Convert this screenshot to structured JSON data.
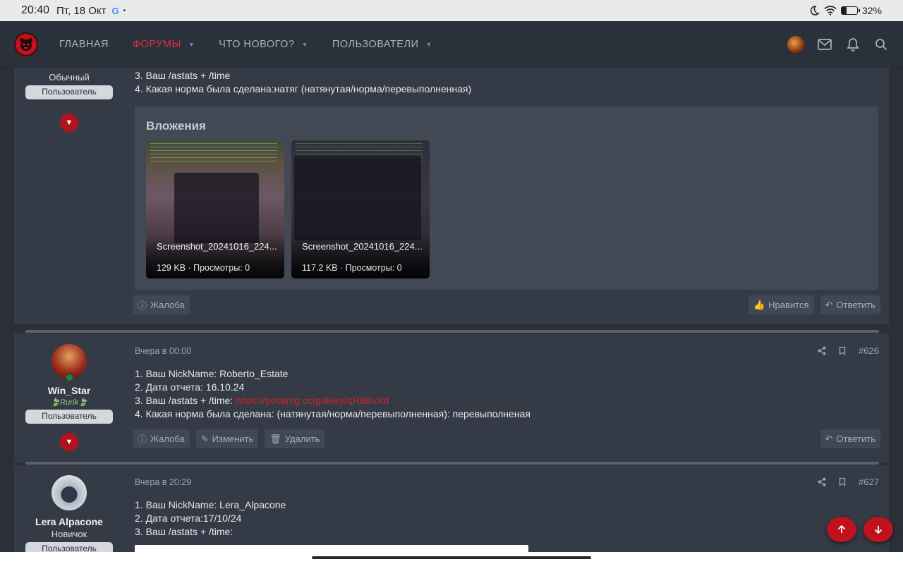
{
  "statusbar": {
    "time": "20:40",
    "date": "Пт, 18 Окт",
    "google": "G",
    "dot": "•",
    "battery_percent": "32",
    "battery_level": 0.32
  },
  "nav": {
    "items": [
      {
        "label": "ГЛАВНАЯ",
        "active": false
      },
      {
        "label": "ФОРУМЫ",
        "active": true
      },
      {
        "label": "ЧТО НОВОГО?",
        "active": false
      },
      {
        "label": "ПОЛЬЗОВАТЕЛИ",
        "active": false
      }
    ]
  },
  "post1": {
    "user_title": "Обычный",
    "role": "Пользователь",
    "lines": [
      "3. Ваш /astats + /time",
      "4. Какая норма была сделана:натяг (натянутая/норма/перевыполненная)"
    ],
    "attachments_title": "Вложения",
    "attachments": [
      {
        "name": "Screenshot_20241016_224...",
        "size": "129 KB",
        "views": "Просмотры: 0"
      },
      {
        "name": "Screenshot_20241016_224...",
        "size": "117.2 KB",
        "views": "Просмотры: 0"
      }
    ],
    "actions": {
      "report": "Жалоба",
      "like": "Нравится",
      "reply": "Ответить"
    }
  },
  "post2": {
    "username": "Win_Star",
    "user_title": "🍃Rurik🍃",
    "role": "Пользователь",
    "time": "Вчера в 00:00",
    "number": "#626",
    "lines": [
      "1. Ваш NickName: Roberto_Estate",
      "2. Дата отчета: 16.10.24"
    ],
    "line3_prefix": "3. Ваш /astats + /time: ",
    "line3_link": "https://postimg.cc/gallery/qR8BvXd",
    "line4": "4. Какая норма была сделана: (натянутая/норма/перевыполненная): перевыполненая",
    "actions": {
      "report": "Жалоба",
      "edit": "Изменить",
      "delete": "Удалить",
      "reply": "Ответить"
    }
  },
  "post3": {
    "username": "Lera Alpacone",
    "user_title": "Новичок",
    "role": "Пользователь",
    "time": "Вчера в 20:29",
    "number": "#627",
    "lines": [
      "1. Ваш NickName: Lera_Alpacone",
      "2. Дата отчета:17/10/24",
      "3. Ваш /astats + /time:"
    ]
  },
  "colors": {
    "accent": "#c1121f",
    "nav_bg": "#2b313b",
    "post_bg": "#353b46"
  }
}
